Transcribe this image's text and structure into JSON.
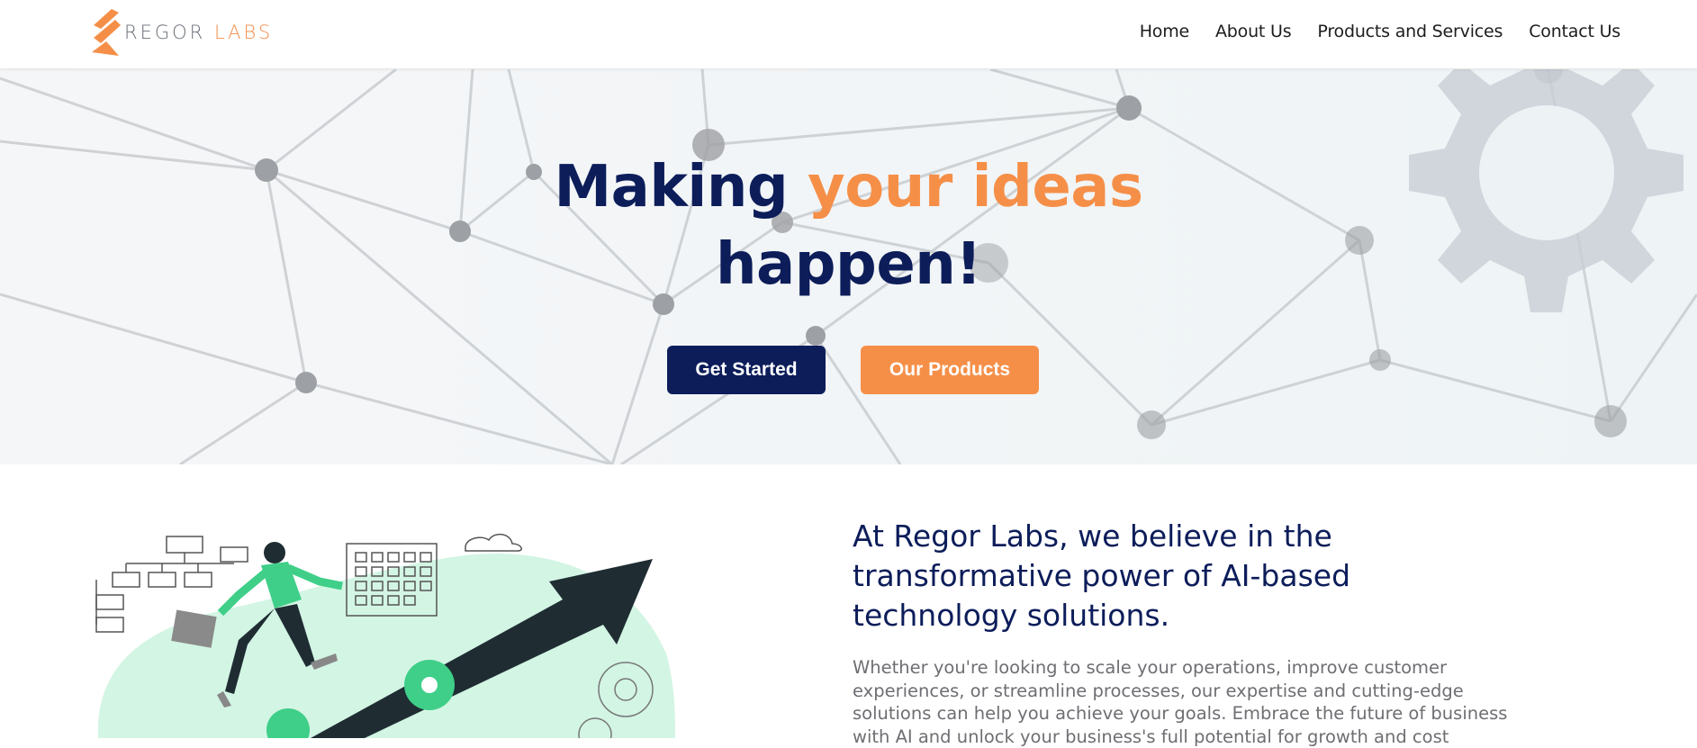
{
  "brand": {
    "name_part1": "REGOR",
    "name_part2": " LABS",
    "colors": {
      "navy": "#0c1d5a",
      "orange": "#f58f48",
      "gray": "#6b7078"
    }
  },
  "nav": {
    "items": [
      {
        "label": "Home"
      },
      {
        "label": "About Us"
      },
      {
        "label": "Products and Services"
      },
      {
        "label": "Contact Us"
      }
    ]
  },
  "hero": {
    "title_part1": "Making ",
    "title_accent": "your ideas",
    "title_part2": "happen!",
    "primary_button": "Get Started",
    "secondary_button": "Our Products"
  },
  "about": {
    "heading": "At Regor Labs, we believe in the transformative power of AI-based technology solutions.",
    "body": "Whether you're looking to scale your operations, improve customer experiences, or streamline processes, our expertise and cutting-edge solutions can help you achieve your goals. Embrace the future of business with AI and unlock your business's full potential for growth and cost"
  },
  "icons": {
    "logo": "regor-labs-logo-mark",
    "hero_background": "network-nodes-and-gear",
    "illustration": "businessman-running-on-growth-arrow"
  }
}
